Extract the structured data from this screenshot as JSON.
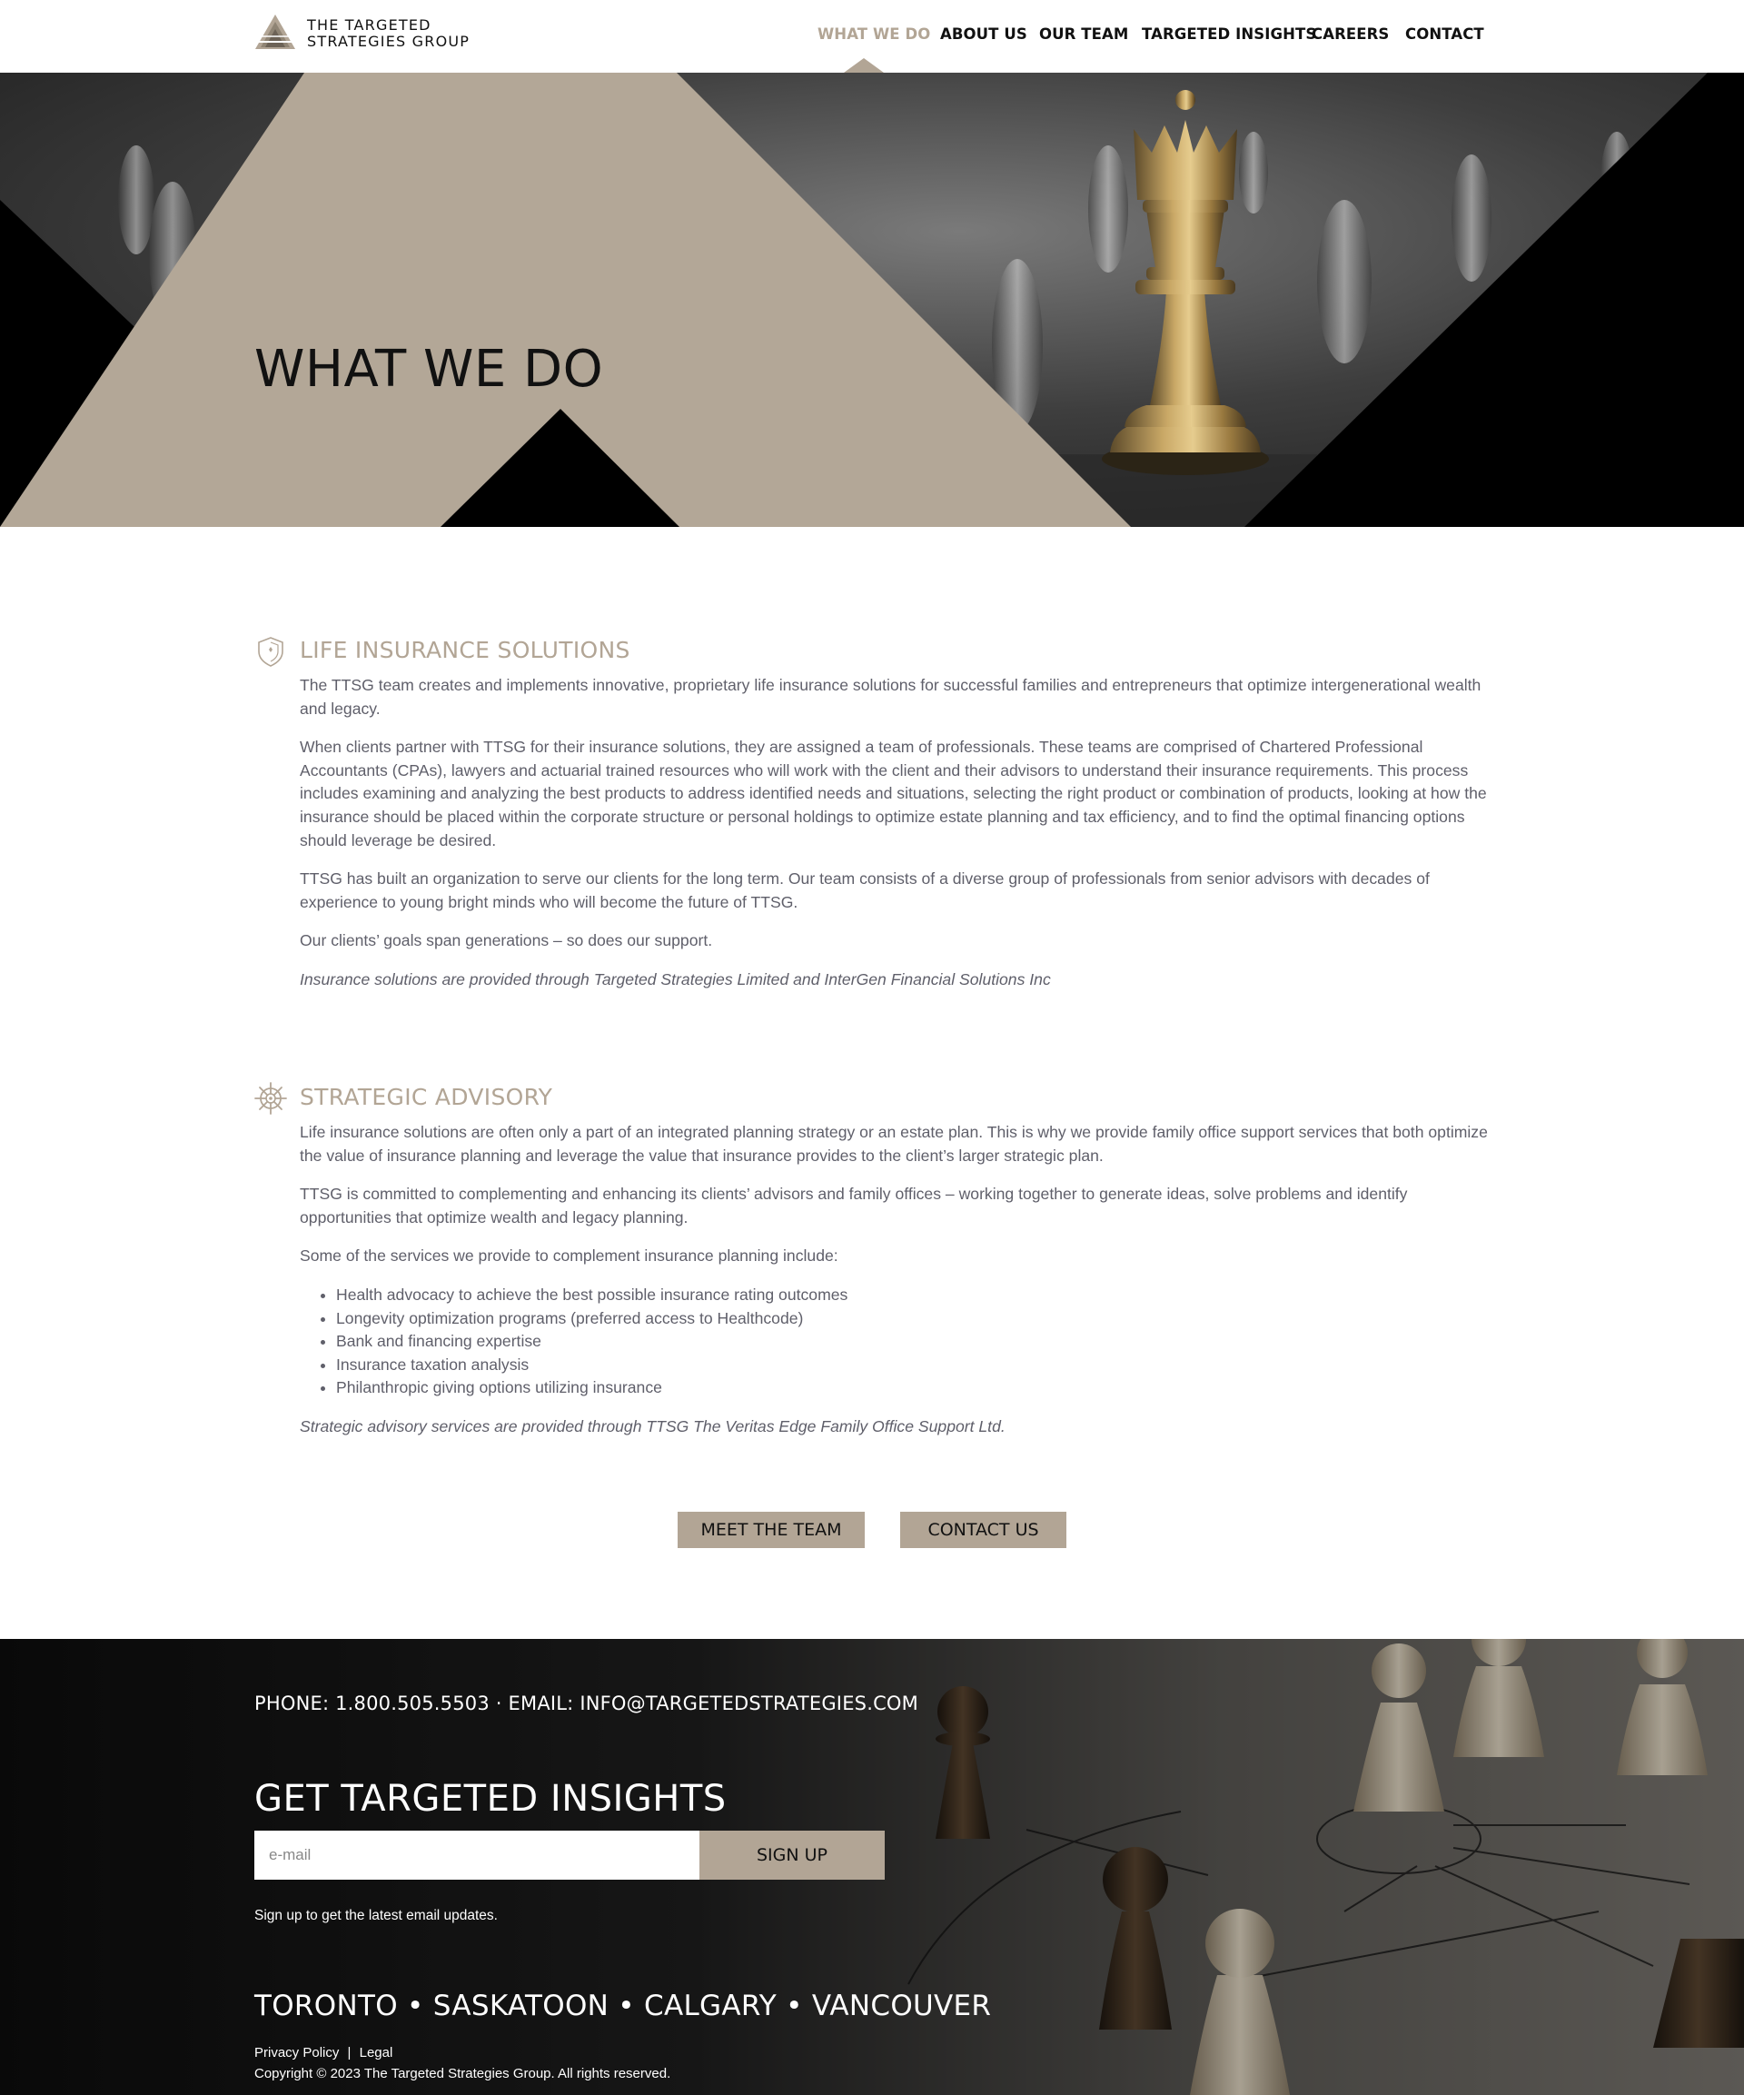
{
  "brand": {
    "name_line1": "THE TARGETED",
    "name_line2": "STRATEGIES GROUP",
    "accent_color": "#b2a595"
  },
  "nav": {
    "items": [
      {
        "label": "WHAT WE DO",
        "active": true
      },
      {
        "label": "ABOUT US",
        "active": false
      },
      {
        "label": "OUR TEAM",
        "active": false
      },
      {
        "label": "TARGETED INSIGHTS",
        "active": false
      },
      {
        "label": "CAREERS",
        "active": false
      },
      {
        "label": "CONTACT",
        "active": false
      }
    ]
  },
  "hero": {
    "title": "WHAT WE DO"
  },
  "sections": {
    "life": {
      "icon": "shield-icon",
      "title": "LIFE INSURANCE SOLUTIONS",
      "p1": "The TTSG team creates and implements innovative, proprietary life insurance solutions for successful families and entrepreneurs that optimize intergenerational wealth and legacy.",
      "p2": "When clients partner with TTSG for their insurance solutions, they are assigned a team of professionals. These teams are comprised of Chartered Professional Accountants (CPAs), lawyers and actuarial trained resources who will work with the client and their advisors to understand their insurance requirements. This process includes examining and analyzing the best products to address identified needs and situations, selecting the right product or combination of products, looking at how the insurance should be placed within the corporate structure or personal holdings to optimize estate planning and tax efficiency, and to find the optimal financing options should leverage be desired.",
      "p3": "TTSG has built an organization to serve our clients for the long term. Our team consists of a diverse group of professionals from senior advisors with decades of experience to young bright minds who will become the future of TTSG.",
      "p4": "Our clients’ goals span generations – so does our support.",
      "note": "Insurance solutions are provided through Targeted Strategies Limited and InterGen Financial Solutions Inc"
    },
    "advisory": {
      "icon": "ship-wheel-icon",
      "title": "STRATEGIC ADVISORY",
      "p1": "Life insurance solutions are often only a part of an integrated planning strategy or an estate plan. This is why we provide family office support services that both optimize the value of insurance planning and leverage the value that insurance provides to the client’s larger strategic plan.",
      "p2": "TTSG is committed to complementing and enhancing its clients’ advisors and family offices – working together to generate ideas, solve problems and identify opportunities that optimize wealth and legacy planning.",
      "p3": "Some of the services we provide to complement insurance planning include:",
      "list": [
        "Health advocacy to achieve the best possible insurance rating outcomes",
        "Longevity optimization programs (preferred access to Healthcode)",
        "Bank and financing expertise",
        "Insurance taxation analysis",
        "Philanthropic giving options utilizing insurance"
      ],
      "note": "Strategic advisory services are provided through TTSG The Veritas Edge Family Office Support Ltd."
    }
  },
  "buttons": {
    "meet_team": "MEET THE TEAM",
    "contact_us": "CONTACT US"
  },
  "footer": {
    "contact_line": "PHONE: 1.800.505.5503 · EMAIL: INFO@TARGETEDSTRATEGIES.COM",
    "insights_title": "GET TARGETED INSIGHTS",
    "email_placeholder": "e-mail",
    "signup_label": "SIGN UP",
    "signup_note": "Sign up to get the latest email updates.",
    "cities": "TORONTO • SASKATOON • CALGARY • VANCOUVER",
    "privacy_label": "Privacy Policy",
    "separator": "|",
    "legal_label": "Legal",
    "copyright": "Copyright © 2023 The Targeted Strategies Group. All rights reserved."
  }
}
